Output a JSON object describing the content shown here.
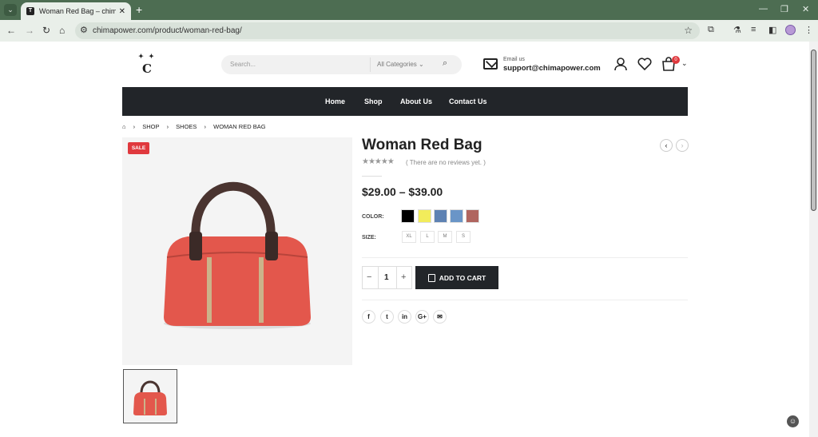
{
  "browser": {
    "tab_title": "Woman Red Bag – chimapower",
    "favicon_letter": "T",
    "url": "chimapower.com/product/woman-red-bag/"
  },
  "header": {
    "logo_letter": "C",
    "logo_sparks": "✦ ✦",
    "search_placeholder": "Search...",
    "category_select": "All Categories",
    "email_label": "Email us",
    "email_value": "support@chimapower.com",
    "cart_count": "0"
  },
  "nav": {
    "items": [
      "Home",
      "Shop",
      "About Us",
      "Contact Us"
    ]
  },
  "breadcrumb": [
    "SHOP",
    "SHOES",
    "WOMAN RED BAG"
  ],
  "product": {
    "badge": "SALE",
    "title": "Woman Red Bag",
    "stars": "★★★★★",
    "reviews_text": "( There are no reviews yet. )",
    "price": "$29.00 – $39.00",
    "color_label": "COLOR:",
    "colors": [
      "#000000",
      "#f2ec5b",
      "#5e82b3",
      "#6a95c7",
      "#b0655f"
    ],
    "size_label": "SIZE:",
    "sizes": [
      "XL",
      "L",
      "M",
      "S"
    ],
    "quantity": "1",
    "add_to_cart": "ADD TO CART"
  },
  "share": [
    "f",
    "t",
    "in",
    "G+",
    "✉"
  ],
  "icons": {
    "user": "user-icon",
    "wishlist": "heart-icon",
    "cart": "cart-icon"
  }
}
